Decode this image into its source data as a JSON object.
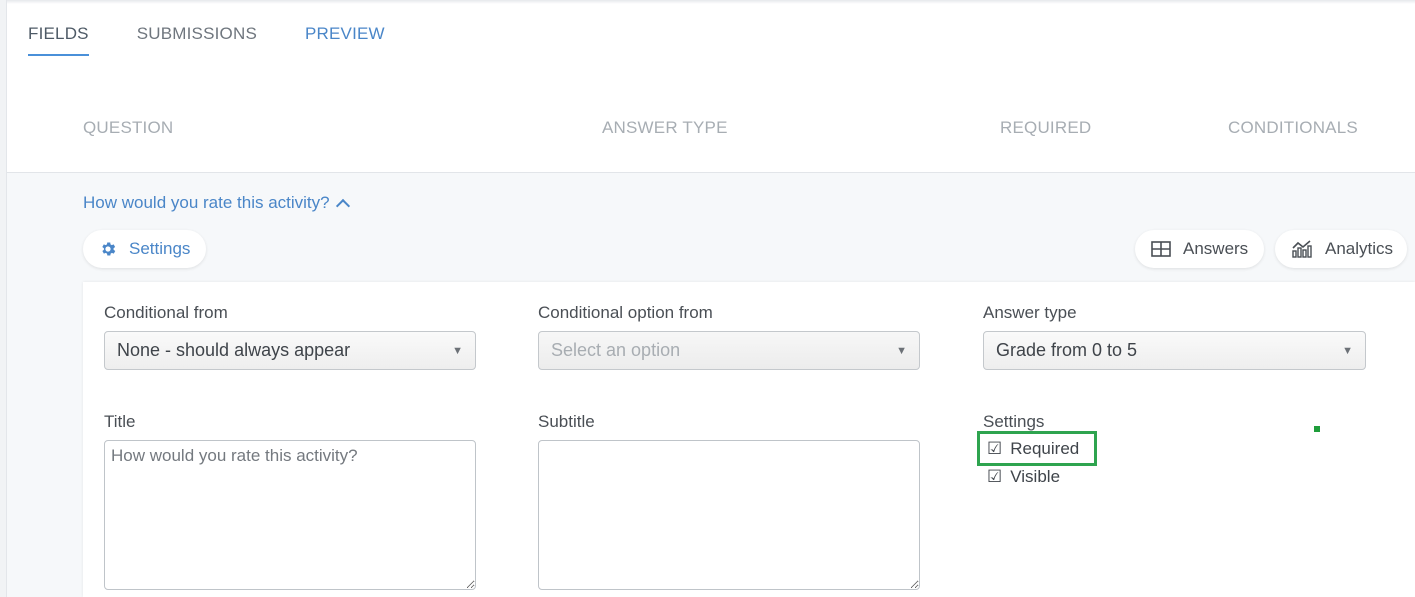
{
  "tabs": [
    {
      "label": "FIELDS"
    },
    {
      "label": "SUBMISSIONS"
    },
    {
      "label": "PREVIEW"
    }
  ],
  "columns": {
    "question": "QUESTION",
    "answer_type": "ANSWER TYPE",
    "required": "REQUIRED",
    "conditionals": "CONDITIONALS"
  },
  "question": {
    "text": "How would you rate this activity?"
  },
  "buttons": {
    "settings": "Settings",
    "answers": "Answers",
    "analytics": "Analytics"
  },
  "form": {
    "conditional_from": {
      "label": "Conditional from",
      "value": "None - should always appear"
    },
    "conditional_option": {
      "label": "Conditional option from",
      "placeholder": "Select an option"
    },
    "answer_type": {
      "label": "Answer type",
      "value": "Grade from 0 to 5"
    },
    "title": {
      "label": "Title",
      "placeholder": "How would you rate this activity?"
    },
    "subtitle": {
      "label": "Subtitle",
      "placeholder": ""
    },
    "settings": {
      "label": "Settings",
      "required": "Required",
      "visible": "Visible"
    }
  },
  "icons": {
    "gear": "gear-icon",
    "table": "table-icon",
    "analytics": "analytics-icon",
    "chevron": "chevron-up-icon",
    "checkbox": "checkbox-checked-icon"
  },
  "colors": {
    "accent": "#4a86c8",
    "highlight": "#2ea44f"
  }
}
